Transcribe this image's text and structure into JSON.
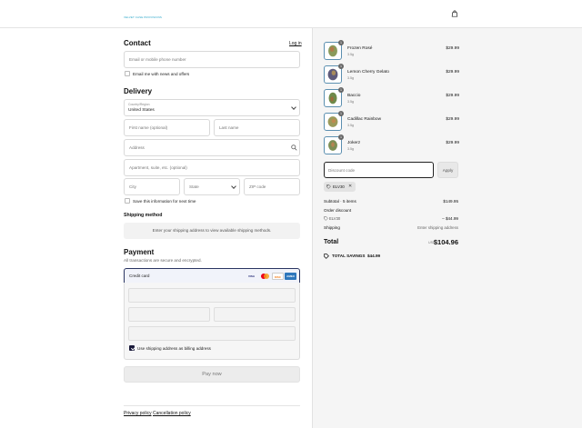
{
  "header": {
    "logo_text": "VELVET CASE PROVISIONS",
    "bag_icon": "shopping-bag-icon"
  },
  "contact": {
    "title": "Contact",
    "login_link": "Log in",
    "email_placeholder": "Email or mobile phone number",
    "newsletter_label": "Email me with news and offers"
  },
  "delivery": {
    "title": "Delivery",
    "country_label": "Country/Region",
    "country_value": "United States",
    "first_name_placeholder": "First name (optional)",
    "last_name_placeholder": "Last name",
    "address_placeholder": "Address",
    "apartment_placeholder": "Apartment, suite, etc. (optional)",
    "city_placeholder": "City",
    "state_placeholder": "State",
    "zip_placeholder": "ZIP code",
    "save_info_label": "Save this information for next time"
  },
  "shipping_method": {
    "title": "Shipping method",
    "message": "Enter your shipping address to view available shipping methods."
  },
  "payment": {
    "title": "Payment",
    "subtitle": "All transactions are secure and encrypted.",
    "credit_card_label": "Credit card",
    "cards": [
      "VISA",
      "MC",
      "DISC",
      "AMEX"
    ],
    "billing_label": "Use shipping address as billing address",
    "pay_button": "Pay now"
  },
  "footer": {
    "privacy": "Privacy policy",
    "cancellation": "Cancellation policy"
  },
  "order": {
    "items": [
      {
        "name": "Frozen Rosé",
        "variant": "3.5g",
        "price": "$29.99",
        "qty": "1"
      },
      {
        "name": "Lemon Cherry Gelato",
        "variant": "3.5g",
        "price": "$29.99",
        "qty": "1"
      },
      {
        "name": "Baccio",
        "variant": "3.5g",
        "price": "$29.99",
        "qty": "1"
      },
      {
        "name": "Cadillac Rainbow",
        "variant": "3.5g",
        "price": "$29.99",
        "qty": "1"
      },
      {
        "name": "Jokerz",
        "variant": "3.5g",
        "price": "$29.99",
        "qty": "1"
      }
    ],
    "discount_placeholder": "Discount code",
    "apply_label": "Apply",
    "applied_code": "ELV30",
    "subtotal_label": "Subtotal · 5 items",
    "subtotal_value": "$149.95",
    "order_discount_label": "Order discount",
    "discount_code": "ELV30",
    "discount_value": "– $44.99",
    "shipping_label": "Shipping",
    "shipping_value": "Enter shipping address",
    "total_label": "Total",
    "currency": "USD",
    "total_value": "$104.96",
    "savings_label": "TOTAL SAVINGS",
    "savings_value": "$44.99"
  }
}
